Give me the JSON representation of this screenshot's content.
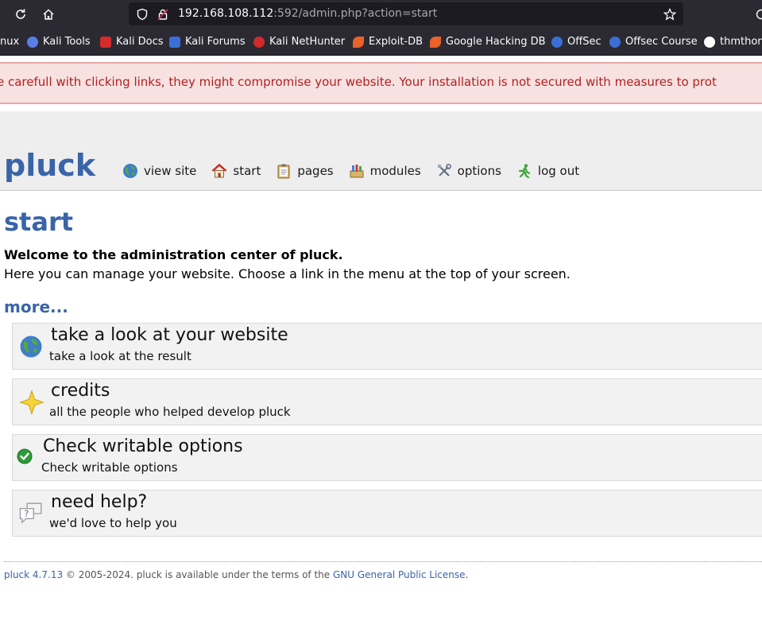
{
  "browser": {
    "url_host": "192.168.108.112",
    "url_rest": ":592/admin.php?action=start",
    "bookmarks": [
      {
        "label": "nux",
        "color": "#2b2a33"
      },
      {
        "label": "Kali Tools",
        "color": "#5b7de8"
      },
      {
        "label": "Kali Docs",
        "color": "#d62b2b"
      },
      {
        "label": "Kali Forums",
        "color": "#3b6fd8"
      },
      {
        "label": "Kali NetHunter",
        "color": "#d12a2a"
      },
      {
        "label": "Exploit-DB",
        "color": "#e8622a"
      },
      {
        "label": "Google Hacking DB",
        "color": "#e8622a"
      },
      {
        "label": "OffSec",
        "color": "#3b6fd8"
      },
      {
        "label": "Offsec Course",
        "color": "#3b6fd8"
      },
      {
        "label": "thmthon",
        "color": "#ffffff"
      }
    ]
  },
  "warning": {
    "text": "e carefull with clicking links, they might compromise your website. Your installation is not secured with measures to prot"
  },
  "header": {
    "logo": "pluck",
    "menu": [
      {
        "label": "view site",
        "icon": "globe-icon"
      },
      {
        "label": "start",
        "icon": "home-icon"
      },
      {
        "label": "pages",
        "icon": "clipboard-icon"
      },
      {
        "label": "modules",
        "icon": "modules-icon"
      },
      {
        "label": "options",
        "icon": "tools-icon"
      },
      {
        "label": "log out",
        "icon": "running-man-icon"
      }
    ]
  },
  "main": {
    "title": "start",
    "welcome_strong": "Welcome to the administration center of pluck.",
    "welcome_text": "Here you can manage your website. Choose a link in the menu at the top of your screen.",
    "more": "more...",
    "cards": [
      {
        "title": "take a look at your website",
        "subtitle": "take a look at the result",
        "icon": "globe-icon"
      },
      {
        "title": "credits",
        "subtitle": "all the people who helped develop pluck",
        "icon": "star-icon"
      },
      {
        "title": "Check writable options",
        "subtitle": "Check writable options",
        "icon": "check-icon"
      },
      {
        "title": "need help?",
        "subtitle": "we'd love to help you",
        "icon": "help-bubbles-icon"
      }
    ]
  },
  "footer": {
    "version_link": "pluck 4.7.13",
    "text": " © 2005-2024. pluck is available under the terms of the ",
    "license_link": "GNU General Public License",
    "end": "."
  },
  "colors": {
    "accent": "#3a64a8",
    "warning_bg": "#f8e1e1",
    "warning_text": "#b02222"
  }
}
